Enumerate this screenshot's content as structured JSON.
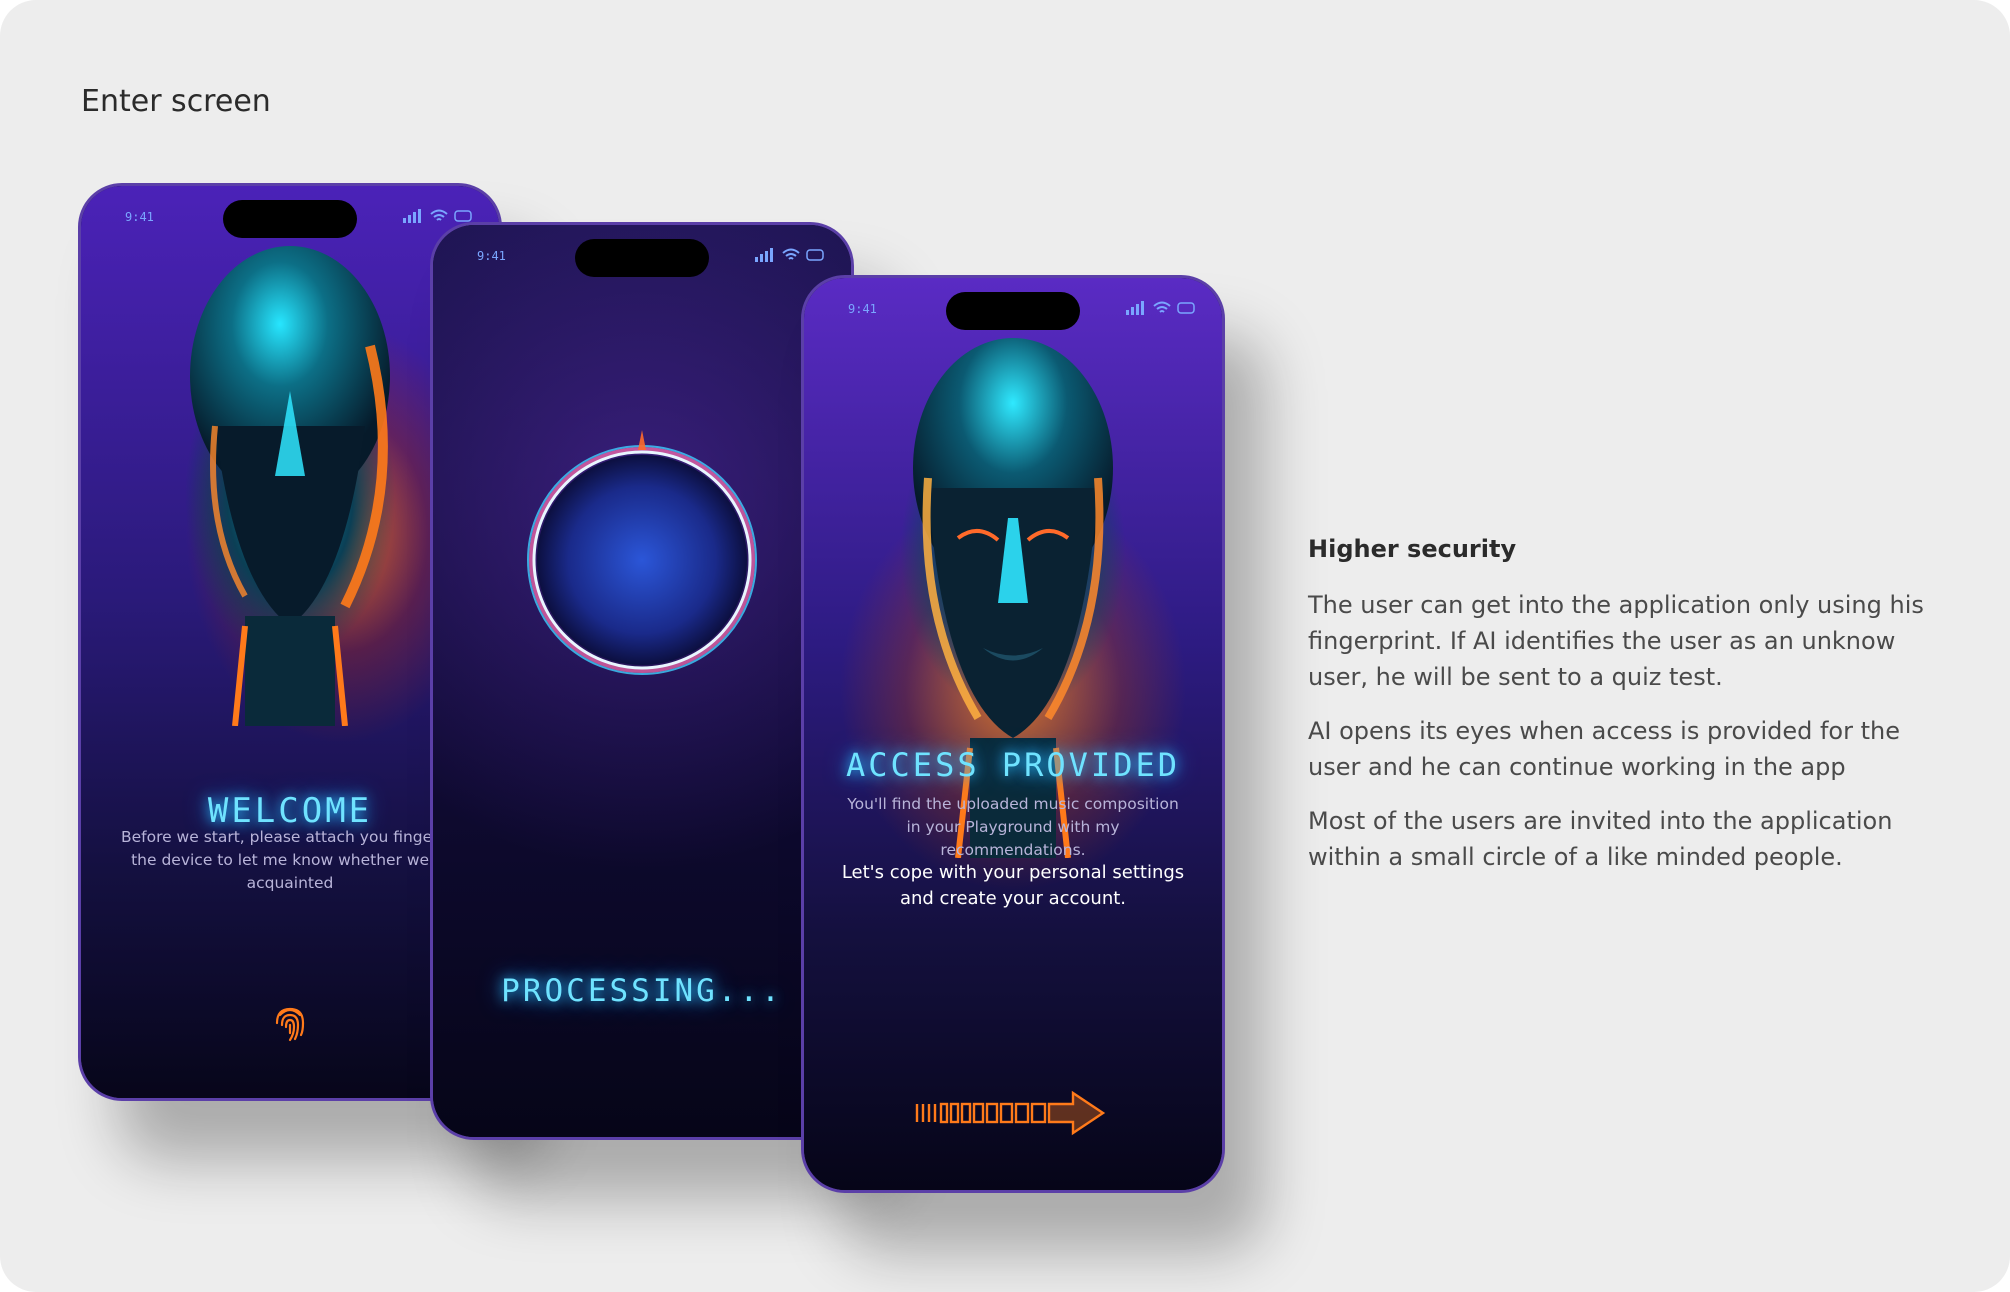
{
  "section": {
    "title": "Enter screen"
  },
  "phones": [
    {
      "time": "9:41",
      "title": "WELCOME",
      "text": "Before we start, please attach you finger to the device to let me know whether we're acquainted"
    },
    {
      "time": "9:41",
      "title": "PROCESSING..."
    },
    {
      "time": "9:41",
      "title": "ACCESS PROVIDED",
      "text": "You'll find the uploaded music composition in your Playground with my recommendations.",
      "cta": "Let's cope with your personal settings and create your account."
    }
  ],
  "description": {
    "heading": "Higher security",
    "paragraphs": [
      "The user can get into the application only using his fingerprint. If AI identifies the user as an unknow user, he will be sent to a quiz test.",
      "AI opens its eyes when access is provided for the user and he can continue working in the app",
      "Most of the users are invited into the application within a small circle of a like minded people."
    ]
  },
  "colors": {
    "accent_cyan": "#6fe3ff",
    "accent_orange": "#ff7a1a",
    "phone_border": "#5b3fa8",
    "board_bg": "#ededed"
  },
  "icons": [
    "fingerprint-icon",
    "arrow-right-icon",
    "signal-icon",
    "wifi-icon",
    "battery-icon"
  ]
}
